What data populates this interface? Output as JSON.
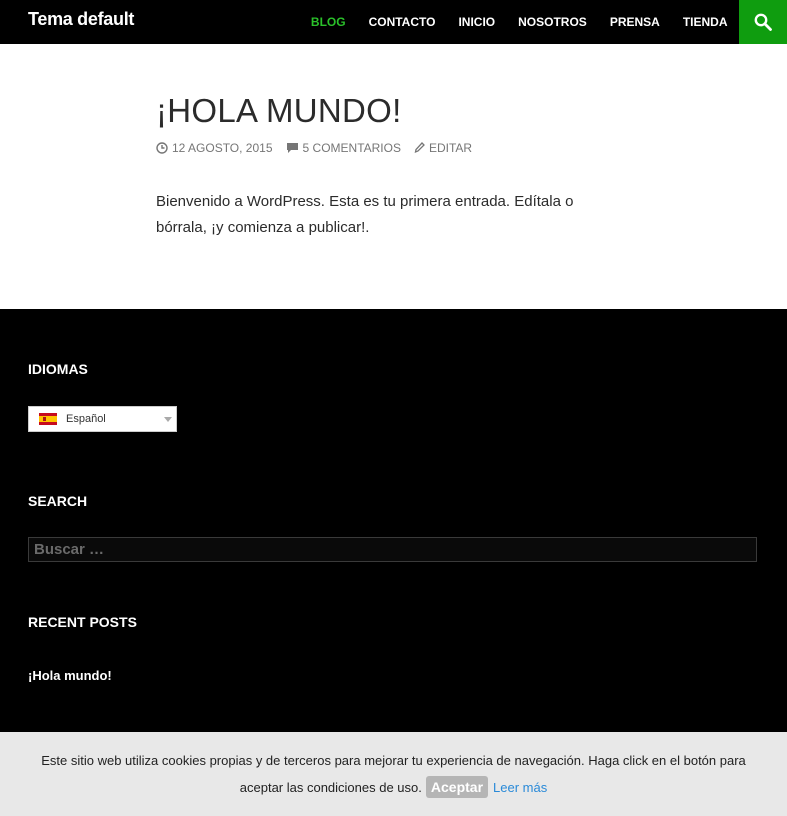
{
  "header": {
    "site_title": "Tema default",
    "nav": [
      {
        "label": "BLOG",
        "active": true
      },
      {
        "label": "CONTACTO"
      },
      {
        "label": "INICIO"
      },
      {
        "label": "NOSOTROS"
      },
      {
        "label": "PRENSA"
      },
      {
        "label": "TIENDA"
      }
    ],
    "search_icon": "search-icon",
    "accent_color": "#0f9d0f"
  },
  "post": {
    "title": "¡HOLA MUNDO!",
    "date": "12 AGOSTO, 2015",
    "comments": "5 COMENTARIOS",
    "edit": "EDITAR",
    "body": "Bienvenido a WordPress. Esta es tu primera entrada. Edítala o bórrala, ¡y comienza a publicar!."
  },
  "widgets": {
    "languages_title": "IDIOMAS",
    "language_selected": "Español",
    "search_title": "SEARCH",
    "search_placeholder": "Buscar …",
    "recent_title": "RECENT POSTS",
    "recent_posts": [
      "¡Hola mundo!"
    ]
  },
  "cookie": {
    "line1": "Este sitio web utiliza cookies propias y de terceros para mejorar tu experiencia de navegación. Haga click en el botón para",
    "line2": "aceptar las condiciones de uso.",
    "accept_label": "Aceptar",
    "read_more_label": "Leer más"
  }
}
